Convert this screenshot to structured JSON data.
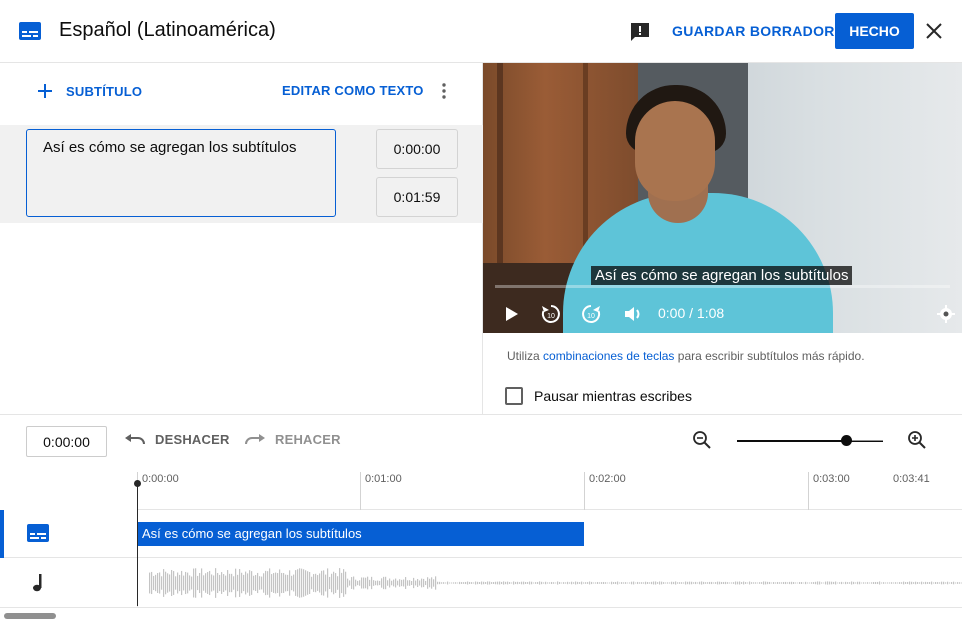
{
  "header": {
    "title": "Español (Latinoamérica)",
    "draft_label": "GUARDAR BORRADOR",
    "done_label": "HECHO"
  },
  "editor": {
    "add_label": "SUBTÍTULO",
    "edit_text_label": "EDITAR COMO TEXTO",
    "cue": {
      "text": "Así es cómo se agregan los subtítulos",
      "start": "0:00:00",
      "end": "0:01:59"
    }
  },
  "video": {
    "caption": "Así es cómo se agregan los subtítulos",
    "time": "0:00 / 1:08"
  },
  "hint": {
    "before": "Utiliza ",
    "link": "combinaciones de teclas",
    "after": " para escribir subtítulos más rápido."
  },
  "pause_label": "Pausar mientras escribes",
  "timeline": {
    "current_time": "0:00:00",
    "undo_label": "DESHACER",
    "redo_label": "REHACER",
    "zoom_level": 0.75,
    "ticks": [
      "0:00:00",
      "0:01:00",
      "0:02:00",
      "0:03:00",
      "0:03:41"
    ],
    "subtitle_bar_text": "Así es cómo se agregan los subtítulos"
  },
  "colors": {
    "accent": "#065fd4",
    "text": "#0d0d0d",
    "muted": "#606060"
  }
}
